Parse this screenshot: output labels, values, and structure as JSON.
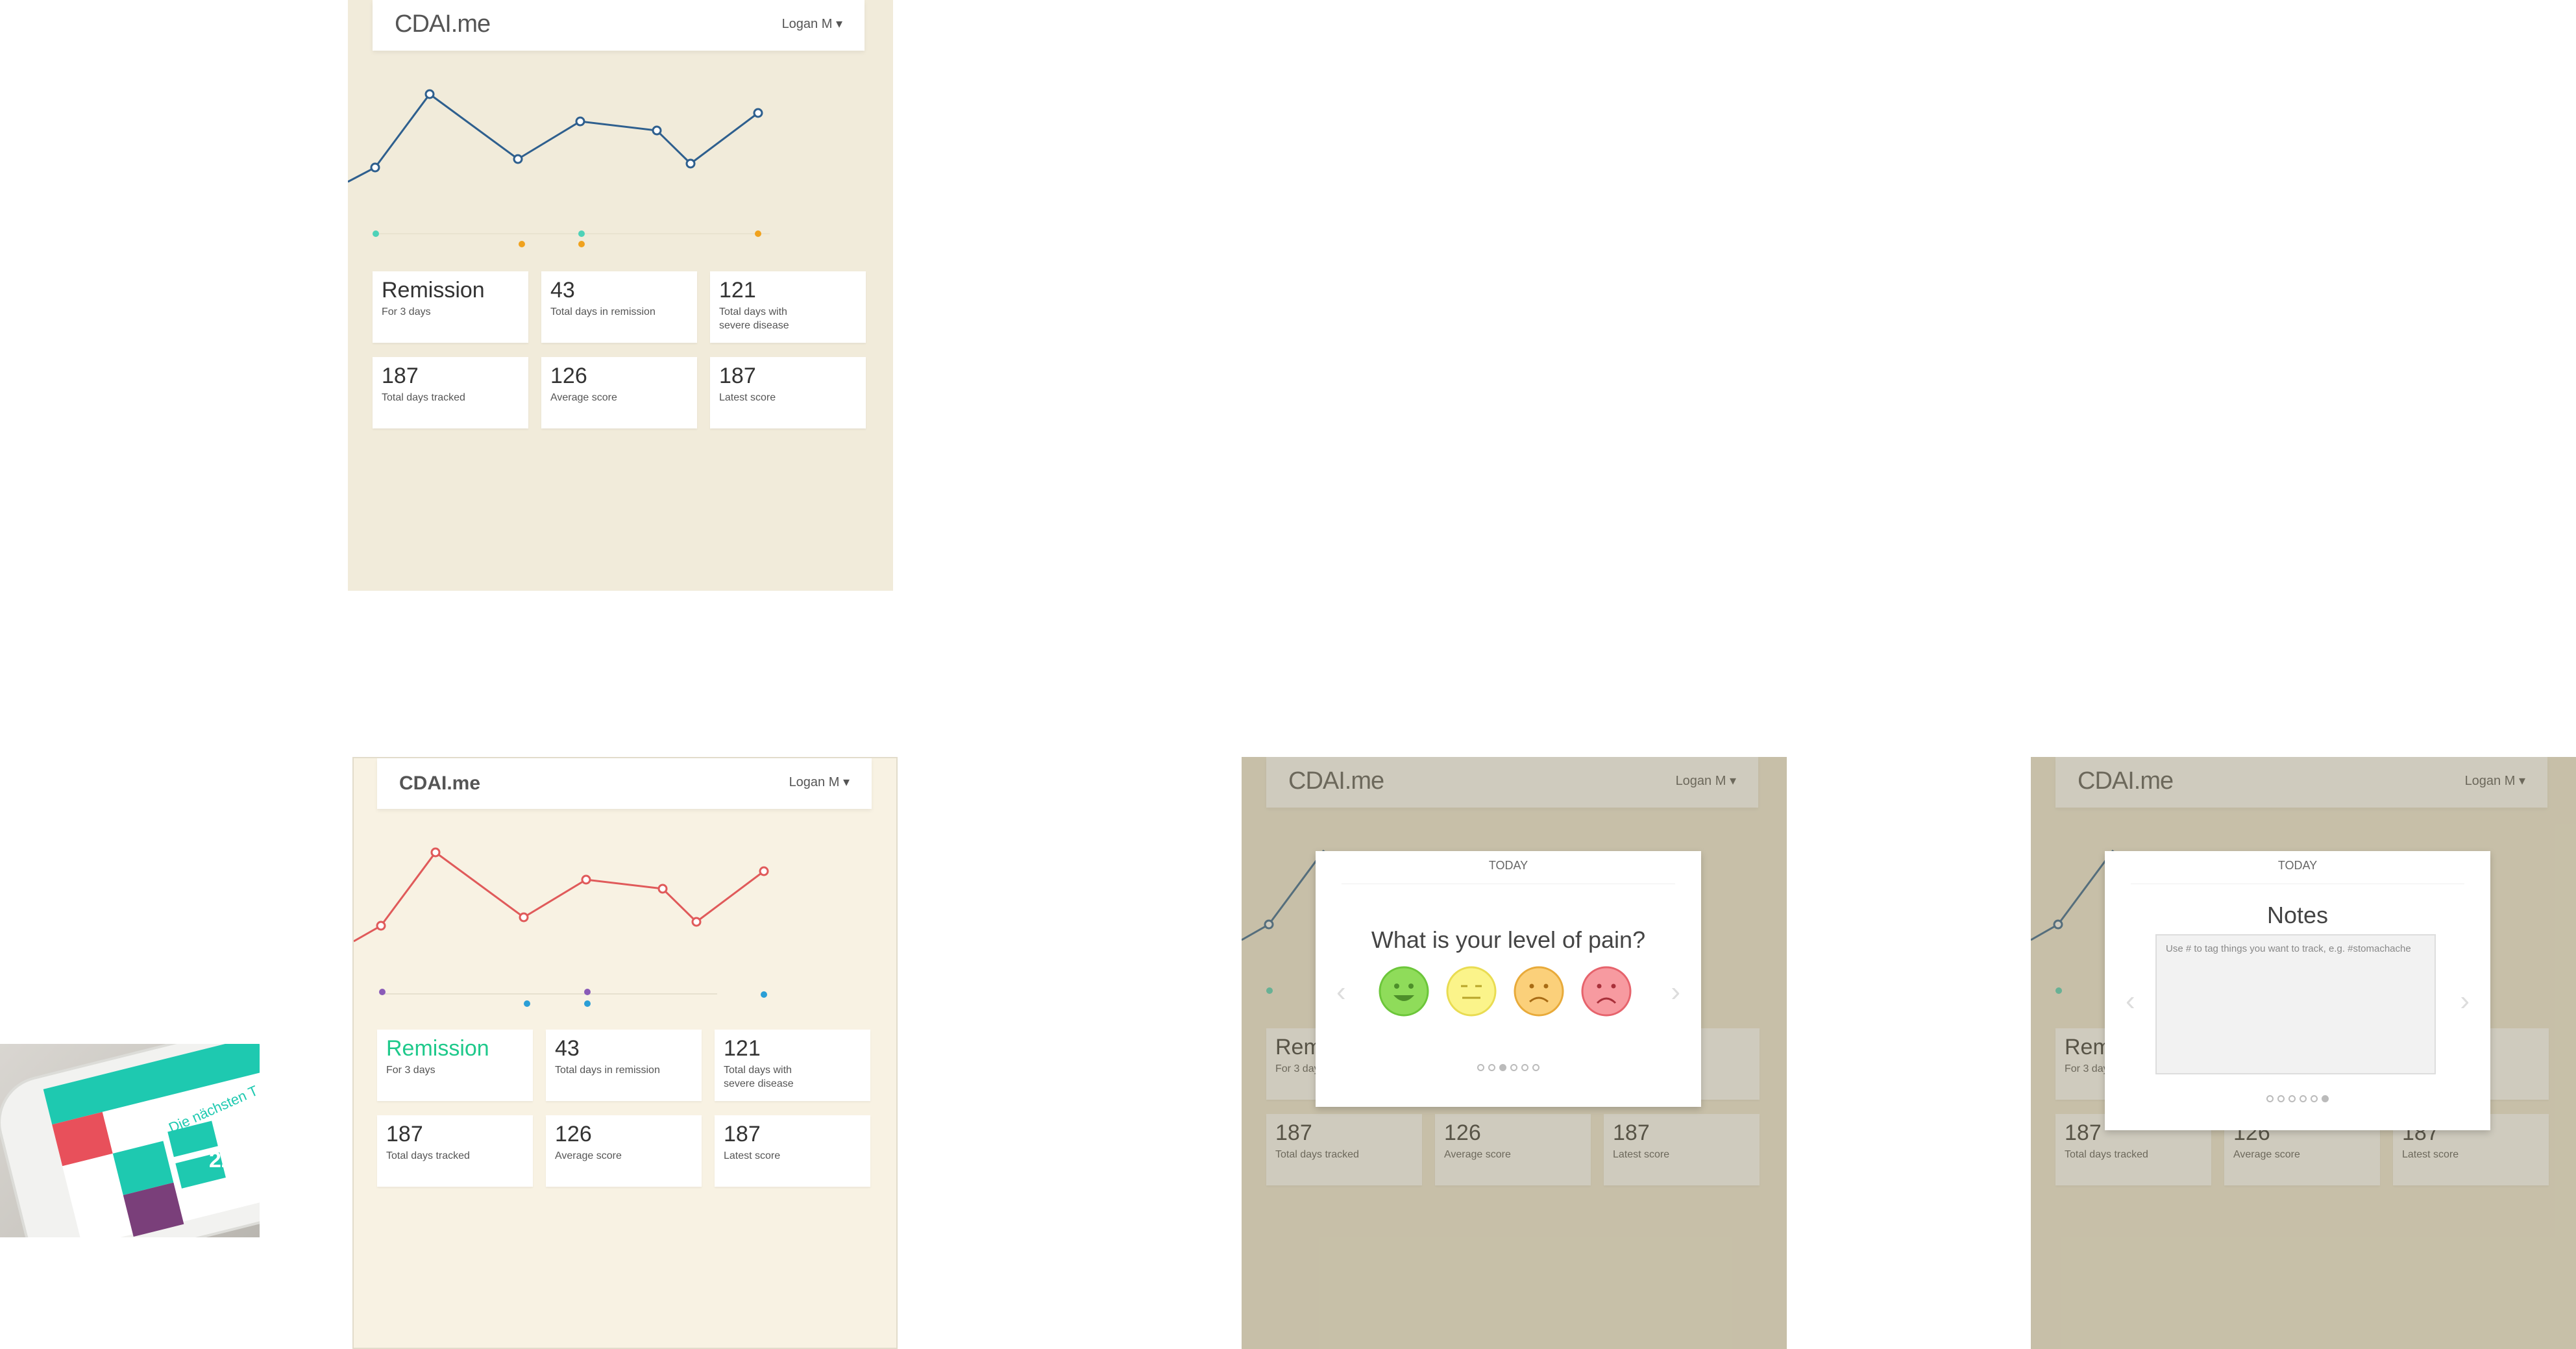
{
  "app": {
    "brand": "CDAI.me",
    "user": "Logan M ▾"
  },
  "stats": [
    {
      "num": "Remission",
      "label": "For 3 days"
    },
    {
      "num": "43",
      "label": "Total days in remission"
    },
    {
      "num": "121",
      "label": "Total days with severe disease"
    },
    {
      "num": "187",
      "label": "Total days tracked"
    },
    {
      "num": "126",
      "label": "Average score"
    },
    {
      "num": "187",
      "label": "Latest score"
    }
  ],
  "pain_modal": {
    "date_label": "TODAY",
    "question": "What is your level of pain?",
    "faces": [
      "smile-face-icon",
      "neutral-face-icon",
      "frown-face-icon",
      "sad-face-icon"
    ],
    "page_dots": 6,
    "active_dot": 3
  },
  "notes_modal": {
    "date_label": "TODAY",
    "heading": "Notes",
    "placeholder": "Use # to tag things you want to track, e.g. #stomachache",
    "page_dots": 6,
    "active_dot": 6
  },
  "thumbnail": {
    "heading": "Die nächsten T",
    "nums": [
      "22",
      "22"
    ]
  },
  "colors": {
    "panel1_bg": "#f1ebda",
    "panel2_bg": "#f8f2e3",
    "line_blue": "#2e5f8e",
    "line_red": "#e05a5a",
    "green_text": "#1ec98b",
    "teal": "#4ed2b8",
    "orange": "#f0a21e",
    "purple": "#8a5bb8",
    "blue_dot": "#2b9fd6"
  },
  "chart_data": {
    "type": "line",
    "values": [
      3,
      8,
      9,
      3,
      7,
      6,
      5,
      4,
      7
    ]
  }
}
